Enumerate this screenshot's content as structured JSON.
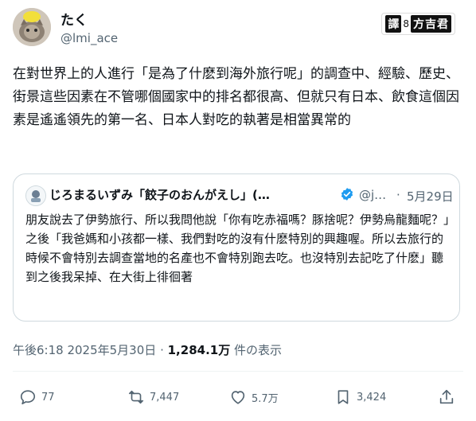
{
  "author": {
    "display_name": "たく",
    "handle": "@lmi_ace"
  },
  "badge": {
    "part1": "譯",
    "part2": "8",
    "part3": "方吉君"
  },
  "tweet": {
    "text": "在對世界上的人進行「是為了什麽到海外旅行呢」的調查中、經驗、歷史、街景這些因素在不管哪個國家中的排名都很高、但就只有日本、飲食這個因素是遙遙領先的第一名、日本人對吃的執著是相當異常的"
  },
  "quote": {
    "name": "じろまるいずみ「餃子のおんがえし」(…",
    "handle": "@j…",
    "separator": "·",
    "date": "5月29日",
    "text": "朋友說去了伊勢旅行、所以我問他說「你有吃赤福嗎？豚捨呢？伊勢烏龍麵呢？」之後「我爸媽和小孩都一樣、我們對吃的沒有什麽特別的興趣喔。所以去旅行的時候不會特別去調查當地的名產也不會特別跑去吃。也沒特別去記吃了什麽」聽到之後我呆掉、在大街上徘徊著"
  },
  "meta": {
    "time": "午後6:18",
    "date": "2025年5月30日",
    "sep": "·",
    "views": "1,284.1万",
    "views_label": "件の表示"
  },
  "actions": {
    "replies": "77",
    "reposts": "7,447",
    "likes": "5.7万",
    "bookmarks": "3,424"
  },
  "colors": {
    "text": "#0f1419",
    "muted": "#536471",
    "border": "#cfd9de",
    "verified": "#1d9bf0"
  }
}
